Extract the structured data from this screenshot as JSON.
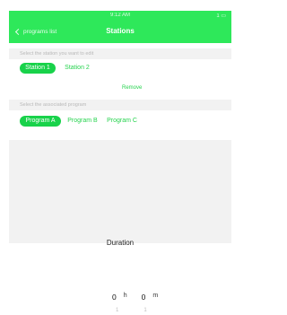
{
  "header": {
    "status_time": "9:12 AM",
    "status_right": "1 ▭",
    "back_label": "programs list",
    "title": "Stations"
  },
  "stations": {
    "section_label": "Select the station you want to edit",
    "items": [
      {
        "label": "Station 1",
        "selected": true
      },
      {
        "label": "Station 2",
        "selected": false
      }
    ],
    "remove_label": "Remove"
  },
  "programs": {
    "section_label": "Select the associated program",
    "items": [
      {
        "label": "Program A",
        "selected": true
      },
      {
        "label": "Program B",
        "selected": false
      },
      {
        "label": "Program C",
        "selected": false
      }
    ]
  },
  "duration": {
    "label": "Duration",
    "hours": "0",
    "hours_unit": "h",
    "minutes": "0",
    "minutes_unit": "m",
    "next_hours": "1",
    "next_minutes": "1"
  },
  "colors": {
    "accent": "#2ee85a",
    "accent_dark": "#18d24a",
    "section_bg": "#f2f2f2"
  }
}
